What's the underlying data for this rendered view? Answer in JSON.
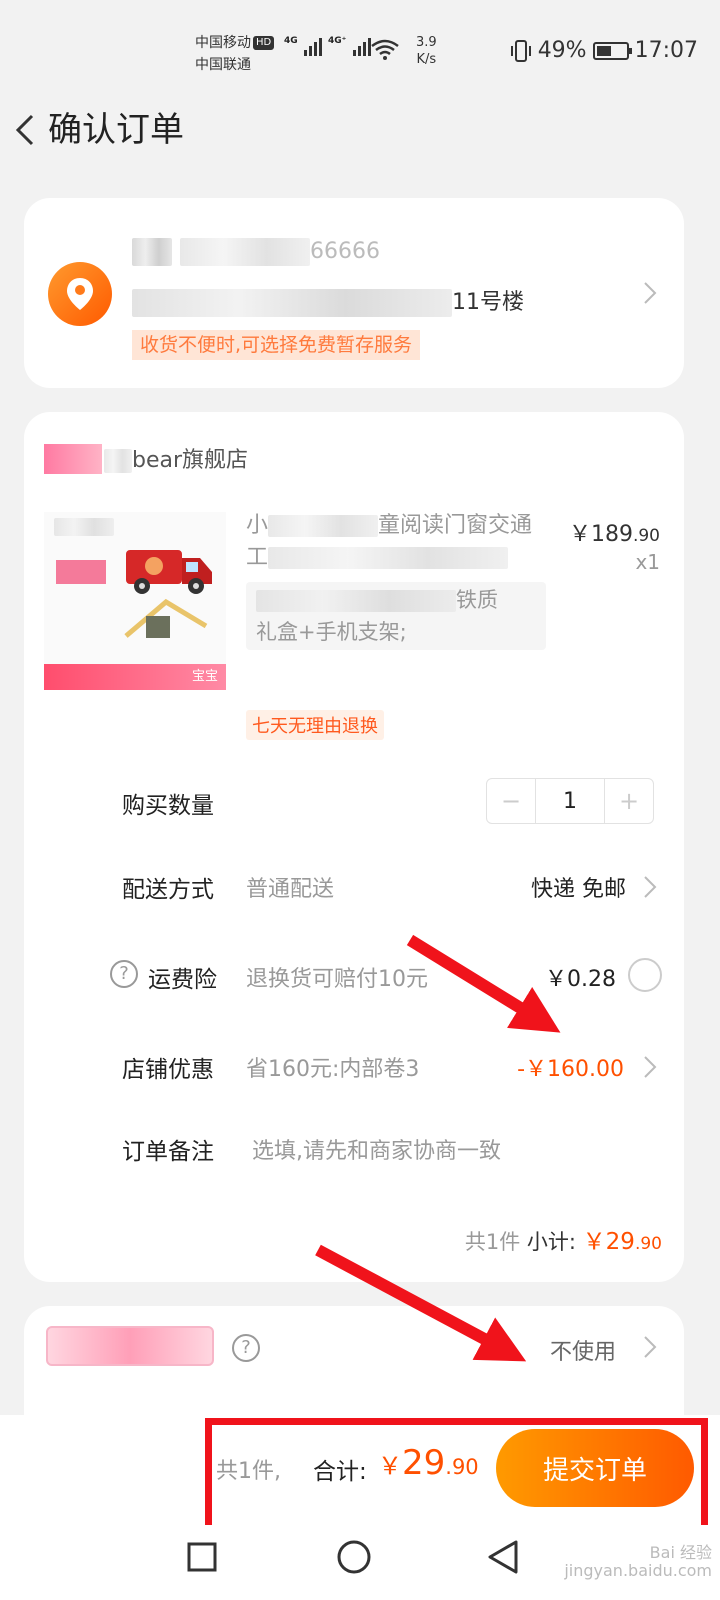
{
  "status_bar": {
    "carrier1": "中国移动",
    "hd_badge": "HD",
    "carrier2": "中国联通",
    "net1": "4G",
    "net2": "4G⁺",
    "speed_value": "3.9",
    "speed_unit": "K/s",
    "battery_percent": "49%",
    "time": "17:07"
  },
  "header": {
    "title": "确认订单"
  },
  "address": {
    "phone_tail": "66666",
    "address_tail": "11号楼",
    "tip": "收货不便时,可选择免费暂存服务"
  },
  "store": {
    "name_tail": "bear旗舰店",
    "product": {
      "title_head": "小",
      "title_mid": "童阅读门窗交通",
      "title_line2": "工",
      "sku_tail": "铁质",
      "sku_line2": "礼盒+手机支架;",
      "img_tag": "宝宝",
      "price_symbol": "￥",
      "price_int": "189",
      "price_dec": ".90",
      "quantity": "x1",
      "return_badge": "七天无理由退换"
    },
    "rows": {
      "qty_label": "购买数量",
      "qty_minus": "−",
      "qty_value": "1",
      "qty_plus": "+",
      "delivery_label": "配送方式",
      "delivery_value": "普通配送",
      "delivery_right": "快递 免邮",
      "insurance_label": "运费险",
      "insurance_value": "退换货可赔付10元",
      "insurance_price": "￥0.28",
      "discount_label": "店铺优惠",
      "discount_value": "省160元:内部卷3",
      "discount_amount": "-￥160.00",
      "note_label": "订单备注",
      "note_placeholder": "选填,请先和商家协商一致"
    },
    "subtotal": {
      "count": "共1件",
      "label": "小计:",
      "symbol": "￥",
      "int": "29",
      "dec": ".90"
    }
  },
  "coupon": {
    "value": "不使用"
  },
  "bottom_bar": {
    "count": "共1件,",
    "total_label": "合计:",
    "symbol": "￥",
    "int": "29",
    "dec": ".90",
    "submit": "提交订单"
  },
  "watermark": {
    "line1": "Bai 经验",
    "line2": "jingyan.baidu.com"
  },
  "colors": {
    "accent": "#ff5000",
    "annotation": "#f0131b"
  }
}
